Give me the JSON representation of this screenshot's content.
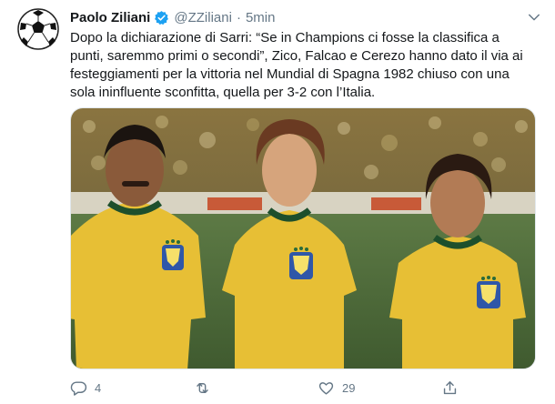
{
  "tweet": {
    "author_name": "Paolo Ziliani",
    "handle": "@ZZiliani",
    "separator": "·",
    "time": "5min",
    "avatar_icon": "soccer-ball-icon",
    "verified_icon": "verified-badge-icon",
    "text": "Dopo la dichiarazione di Sarri: “Se in Champions ci fosse la classifica a punti, saremmo primi o secondi”, Zico, Falcao e Cerezo  hanno dato il via ai festeggiamenti per la vittoria nel Mundial di Spagna 1982 chiuso con una sola ininfluente sconfitta, quella per 3-2 con l’Italia."
  },
  "actions": {
    "reply": {
      "icon": "reply-icon",
      "count": "4"
    },
    "retweet": {
      "icon": "retweet-icon",
      "count": ""
    },
    "like": {
      "icon": "heart-icon",
      "count": "29"
    },
    "share": {
      "icon": "share-icon",
      "count": ""
    }
  },
  "colors": {
    "text_primary": "#14171a",
    "text_secondary": "#657786",
    "verified_blue": "#1da1f2",
    "jersey_yellow": "#e7bf35",
    "jersey_green": "#1d4f2c"
  }
}
